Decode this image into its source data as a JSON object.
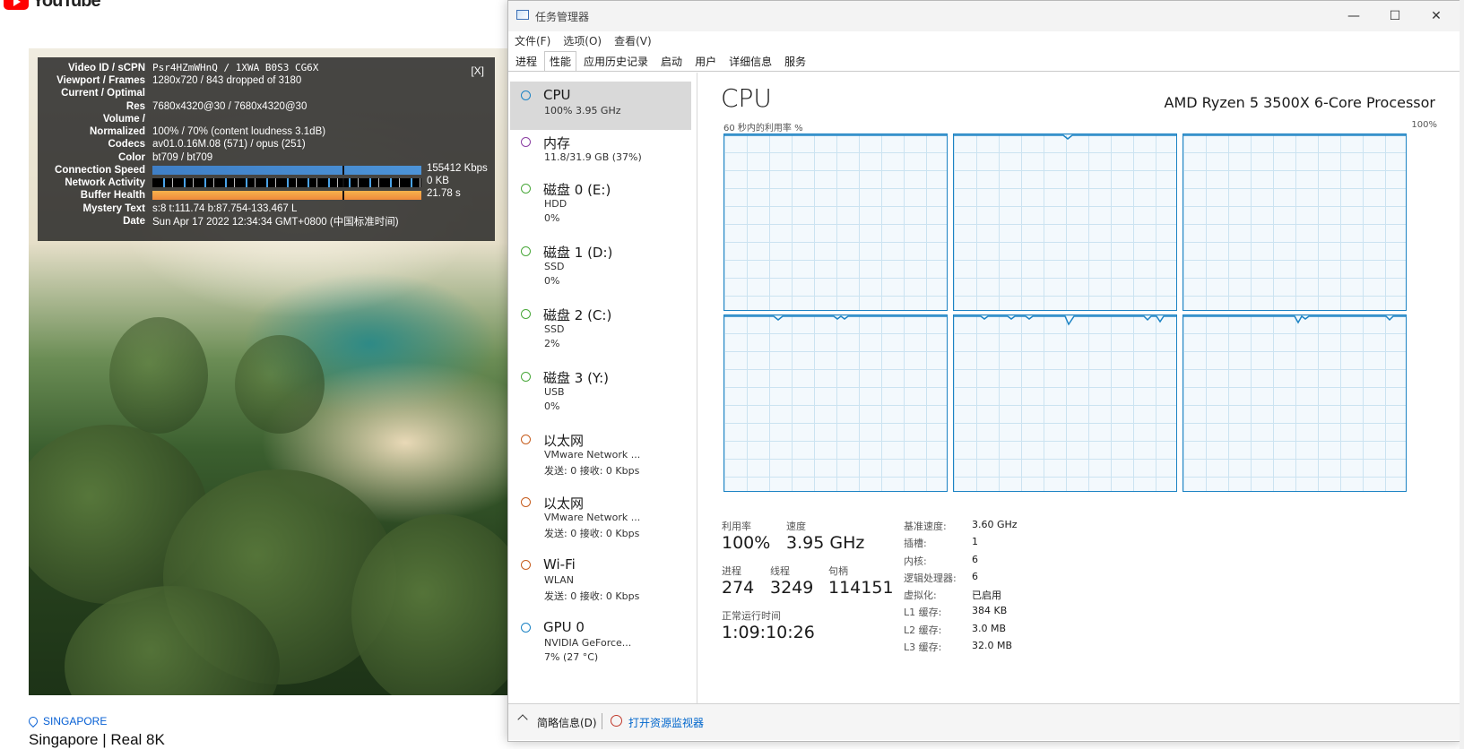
{
  "youtube": {
    "logo_text": "YouTube",
    "location": "SINGAPORE",
    "video_title": "Singapore | Real 8K"
  },
  "stats": {
    "close_label": "[X]",
    "rows": [
      {
        "label": "Video ID / sCPN",
        "value": "Psr4HZmWHnQ / 1XWA B0S3 CG6X"
      },
      {
        "label": "Viewport / Frames",
        "value": "1280x720 / 843 dropped of 3180"
      },
      {
        "label": "Current / Optimal",
        "value": ""
      },
      {
        "label": "Res",
        "value": "7680x4320@30 / 7680x4320@30"
      },
      {
        "label": "Volume /",
        "value": ""
      },
      {
        "label": "Normalized",
        "value": "100% / 70% (content loudness 3.1dB)"
      },
      {
        "label": "Codecs",
        "value": "av01.0.16M.08 (571) / opus (251)"
      },
      {
        "label": "Color",
        "value": "bt709 / bt709"
      },
      {
        "label": "Connection Speed",
        "value": "155412 Kbps"
      },
      {
        "label": "Network Activity",
        "value": "0 KB"
      },
      {
        "label": "Buffer Health",
        "value": "21.78 s"
      },
      {
        "label": "Mystery Text",
        "value": "s:8 t:111.74 b:87.754-133.467 L"
      },
      {
        "label": "Date",
        "value": "Sun Apr 17 2022 12:34:34 GMT+0800 (中国标准时间)"
      }
    ]
  },
  "taskmanager": {
    "title": "任务管理器",
    "window_buttons": {
      "minimize": "—",
      "maximize": "☐",
      "close": "✕"
    },
    "menu": [
      "文件(F)",
      "选项(O)",
      "查看(V)"
    ],
    "tabs": [
      "进程",
      "性能",
      "应用历史记录",
      "启动",
      "用户",
      "详细信息",
      "服务"
    ],
    "active_tab": "性能",
    "sidebar": [
      {
        "name": "CPU",
        "sub1": "100%  3.95 GHz",
        "sub2": "",
        "color": "#1c83c4"
      },
      {
        "name": "内存",
        "sub1": "11.8/31.9 GB (37%)",
        "sub2": "",
        "color": "#8b3fa3"
      },
      {
        "name": "磁盘 0 (E:)",
        "sub1": "HDD",
        "sub2": "0%",
        "color": "#4aa83b"
      },
      {
        "name": "磁盘 1 (D:)",
        "sub1": "SSD",
        "sub2": "0%",
        "color": "#4aa83b"
      },
      {
        "name": "磁盘 2 (C:)",
        "sub1": "SSD",
        "sub2": "2%",
        "color": "#4aa83b"
      },
      {
        "name": "磁盘 3 (Y:)",
        "sub1": "USB",
        "sub2": "0%",
        "color": "#4aa83b"
      },
      {
        "name": "以太网",
        "sub1": "VMware Network ...",
        "sub2": "发送: 0  接收: 0 Kbps",
        "color": "#c65d1e"
      },
      {
        "name": "以太网",
        "sub1": "VMware Network ...",
        "sub2": "发送: 0  接收: 0 Kbps",
        "color": "#c65d1e"
      },
      {
        "name": "Wi-Fi",
        "sub1": "WLAN",
        "sub2": "发送: 0  接收: 0 Kbps",
        "color": "#c65d1e"
      },
      {
        "name": "GPU 0",
        "sub1": "NVIDIA GeForce...",
        "sub2": "7% (27 °C)",
        "color": "#1c83c4"
      }
    ],
    "cpu": {
      "title": "CPU",
      "model": "AMD Ryzen 5 3500X 6-Core Processor",
      "graph_label": "60 秒内的利用率 %",
      "graph_max": "100%",
      "utilization_label": "利用率",
      "utilization": "100%",
      "speed_label": "速度",
      "speed": "3.95 GHz",
      "processes_label": "进程",
      "processes": "274",
      "threads_label": "线程",
      "threads": "3249",
      "handles_label": "句柄",
      "handles": "114151",
      "uptime_label": "正常运行时间",
      "uptime": "1:09:10:26",
      "specs": [
        {
          "label": "基准速度:",
          "value": "3.60 GHz"
        },
        {
          "label": "插槽:",
          "value": "1"
        },
        {
          "label": "内核:",
          "value": "6"
        },
        {
          "label": "逻辑处理器:",
          "value": "6"
        },
        {
          "label": "虚拟化:",
          "value": "已启用"
        },
        {
          "label": "L1 缓存:",
          "value": "384 KB"
        },
        {
          "label": "L2 缓存:",
          "value": "3.0 MB"
        },
        {
          "label": "L3 缓存:",
          "value": "32.0 MB"
        }
      ],
      "line_color": "#1c83c4"
    },
    "footer": {
      "brief": "简略信息(D)",
      "monitor_link": "打开资源监视器"
    }
  }
}
